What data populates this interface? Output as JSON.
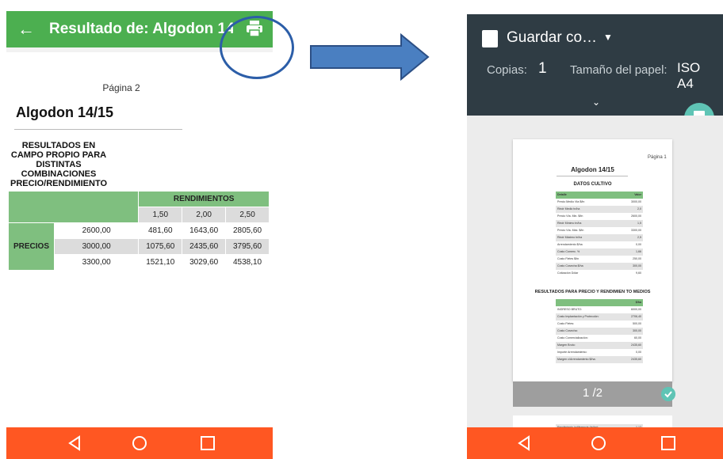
{
  "left_screen": {
    "appbar": {
      "back_icon": "arrow-left-icon",
      "title": "Resultado de: Algodon 14…",
      "print_icon": "print-icon"
    },
    "page": {
      "page_number": "Página 2",
      "title": "Algodon 14/15",
      "subtitle": "RESULTADOS EN CAMPO PROPIO PARA DISTINTAS COMBINACIONES PRECIO/RENDIMIENTO",
      "table": {
        "header": "RENDIMIENTOS",
        "row_label": "PRECIOS",
        "yield_columns": [
          "1,50",
          "2,00",
          "2,50"
        ],
        "rows": [
          {
            "price": "2600,00",
            "values": [
              "481,60",
              "1643,60",
              "2805,60"
            ]
          },
          {
            "price": "3000,00",
            "values": [
              "1075,60",
              "2435,60",
              "3795,60"
            ]
          },
          {
            "price": "3300,00",
            "values": [
              "1521,10",
              "3029,60",
              "4538,10"
            ]
          }
        ]
      }
    },
    "navbar": {
      "back": "nav-back-icon",
      "home": "nav-home-icon",
      "recents": "nav-recents-icon"
    }
  },
  "right_screen": {
    "header": {
      "destination": "Guardar co…",
      "copies_label": "Copias:",
      "copies_value": "1",
      "paper_label": "Tamaño del papel:",
      "paper_value": "ISO A4"
    },
    "preview": {
      "page_number": "Página 1",
      "title": "Algodon 14/15",
      "section1_title": "DATOS CULTIVO",
      "section1_header": [
        "Detalle",
        "Valor"
      ],
      "section1_rows": [
        [
          "Precio Medio Vta $/tn",
          "3000,00"
        ],
        [
          "Rindr Medio tn/ha",
          "2,0"
        ],
        [
          "Precio Vta. Min. $/tn",
          "2600,00"
        ],
        [
          "Rindr Mínimo tn/ha",
          "1,5"
        ],
        [
          "Precio Vta. Máx. $/tn",
          "3300,00"
        ],
        [
          "Rindr Máximo tn/ha",
          "2,5"
        ],
        [
          "Arrendamiento $/ha",
          "0,00"
        ],
        [
          "Costo Comerc. %",
          "1,66"
        ],
        [
          "Costo Fletes $/tn",
          "250,00"
        ],
        [
          "Costo Cosecha $/ha",
          "300,00"
        ],
        [
          "Cotización Dólar",
          "9,60"
        ]
      ],
      "section2_title": "RESULTADOS PARA PRECIO Y RENDIMIEN TO MEDIOS",
      "section2_header": [
        "",
        "$/ha"
      ],
      "section2_rows": [
        [
          "INGRESO BRUTO:",
          "6000,00"
        ],
        [
          "Costo Implantación y Protección:",
          "2706,40"
        ],
        [
          "Costo Fletes:",
          "500,00"
        ],
        [
          "Costo Cosecha:",
          "300,00"
        ],
        [
          "Costo Comercialización:",
          "60,00"
        ],
        [
          "Margen Bruto:",
          "2435,60"
        ],
        [
          "Importe Arrendamiento:",
          "0,00"
        ],
        [
          "Margen c/Arrendamiento $/ha:",
          "2435,60"
        ]
      ],
      "page_indicator": "1 /2",
      "next_page_row": [
        "Rendimiento indiferencia (tn/ha):",
        "1,12"
      ]
    }
  },
  "colors": {
    "appbar_green": "#4caf50",
    "navbar_orange": "#ff5722",
    "header_dark": "#2f3c44",
    "fab_teal": "#5fc4b5",
    "table_green": "#7fbf7f",
    "annotation_blue": "#2c5ea8",
    "arrow_blue": "#4a7fc1"
  }
}
